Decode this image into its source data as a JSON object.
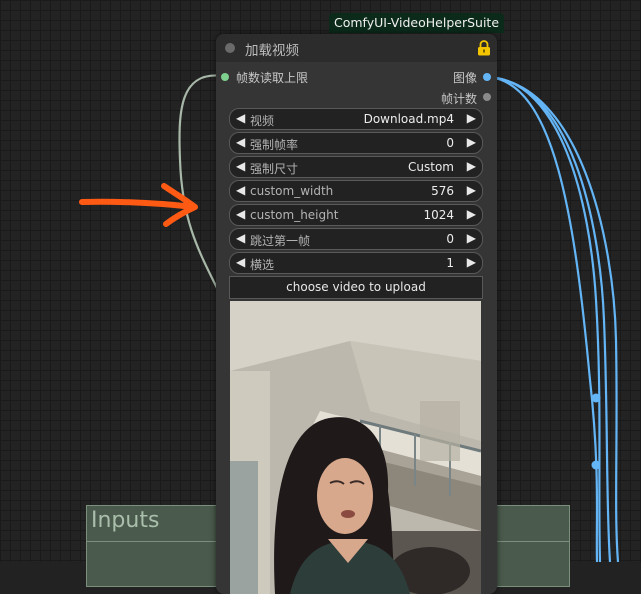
{
  "group": {
    "title": "Inputs"
  },
  "badge": {
    "text": "ComfyUI-VideoHelperSuite"
  },
  "node": {
    "title": "加载视频",
    "input_slot": "帧数读取上限",
    "outputs": [
      {
        "label": "图像",
        "color": "#64b5f6"
      },
      {
        "label": "帧计数",
        "color": "#8a8a8a"
      }
    ],
    "widgets": [
      {
        "name": "视频",
        "value": "Download.mp4"
      },
      {
        "name": "强制帧率",
        "value": "0"
      },
      {
        "name": "强制尺寸",
        "value": "Custom"
      },
      {
        "name": "custom_width",
        "value": "576"
      },
      {
        "name": "custom_height",
        "value": "1024"
      },
      {
        "name": "跳过第一帧",
        "value": "0"
      },
      {
        "name": "横选",
        "value": "1"
      }
    ],
    "arrow_left": "◀",
    "arrow_right": "▶",
    "upload_button": "choose video to upload"
  },
  "colors": {
    "wire_image": "#64b5f6",
    "wire_int": "#a8b8a8",
    "annotation_arrow": "#ff5a14",
    "input_slot": "#7ed08f"
  }
}
